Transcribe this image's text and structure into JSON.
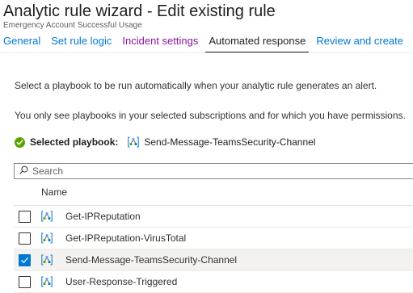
{
  "header": {
    "title": "Analytic rule wizard - Edit existing rule",
    "subtitle": "Emergency Account Successful Usage"
  },
  "tabs": [
    {
      "label": "General",
      "state": "link"
    },
    {
      "label": "Set rule logic",
      "state": "link"
    },
    {
      "label": "Incident settings",
      "state": "visited"
    },
    {
      "label": "Automated response",
      "state": "active"
    },
    {
      "label": "Review and create",
      "state": "link"
    }
  ],
  "instructions": {
    "line1": "Select a playbook to be run automatically when your analytic rule generates an alert.",
    "line2": "You only see playbooks in your selected subscriptions and for which you have permissions."
  },
  "selected_playbook": {
    "label": "Selected playbook:",
    "value": "Send-Message-TeamsSecurity-Channel",
    "status_icon": "success-check-icon",
    "status_color": "#57a300"
  },
  "search": {
    "placeholder": "Search",
    "value": ""
  },
  "table": {
    "column_header": "Name",
    "rows": [
      {
        "name": "Get-IPReputation",
        "checked": false
      },
      {
        "name": "Get-IPReputation-VirusTotal",
        "checked": false
      },
      {
        "name": "Send-Message-TeamsSecurity-Channel",
        "checked": true
      },
      {
        "name": "User-Response-Triggered",
        "checked": false
      }
    ]
  },
  "colors": {
    "link": "#0078d4",
    "visited": "#881798",
    "checkbox_checked": "#0078d4"
  },
  "icons": {
    "playbook": "logic-app-icon",
    "search": "search-icon",
    "checkbox_check": "checkmark-icon"
  }
}
